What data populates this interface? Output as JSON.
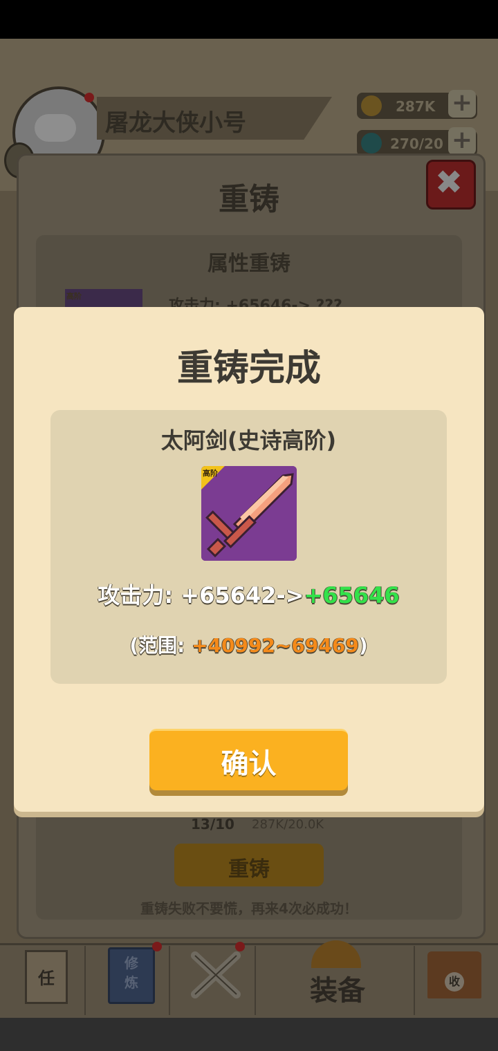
{
  "status_bar": {},
  "hud": {
    "player_name": "屠龙大侠小号",
    "gold": "287K",
    "gems": "270/20",
    "plus_label": "+"
  },
  "reforge_panel": {
    "title": "重铸",
    "close_label": "✖",
    "section_title": "属性重铸",
    "item_badge": "高阶",
    "attr_preview": "攻击力: +65646-> ???",
    "attempts": "13/10",
    "cost": "287K/20.0K",
    "button_label": "重铸",
    "tip": "重铸失败不要慌，再来4次必成功！"
  },
  "modal": {
    "title": "重铸完成",
    "item_name": "太阿剑(史诗高阶)",
    "item_badge": "高阶",
    "stat_label": "攻击力: +65642->",
    "stat_new_value": "+65646",
    "range_prefix": "(范围: ",
    "range_value": "+40992~69469",
    "range_suffix": ")",
    "confirm_label": "确认"
  },
  "bottom_nav": {
    "items": [
      {
        "label": "任",
        "icon": "scroll-icon"
      },
      {
        "label": "修炼",
        "icon": "book-icon"
      },
      {
        "label": "",
        "icon": "crossed-swords-icon"
      },
      {
        "label": "装备",
        "icon": "equipment-icon"
      },
      {
        "label": "收",
        "icon": "hut-icon"
      }
    ]
  },
  "colors": {
    "modal_bg": "#f6e5c1",
    "card_bg": "#e0d3b1",
    "confirm": "#fbb120",
    "stat_new": "#33e24a",
    "range": "#f48a1a",
    "item_bg": "#7b3c92"
  }
}
